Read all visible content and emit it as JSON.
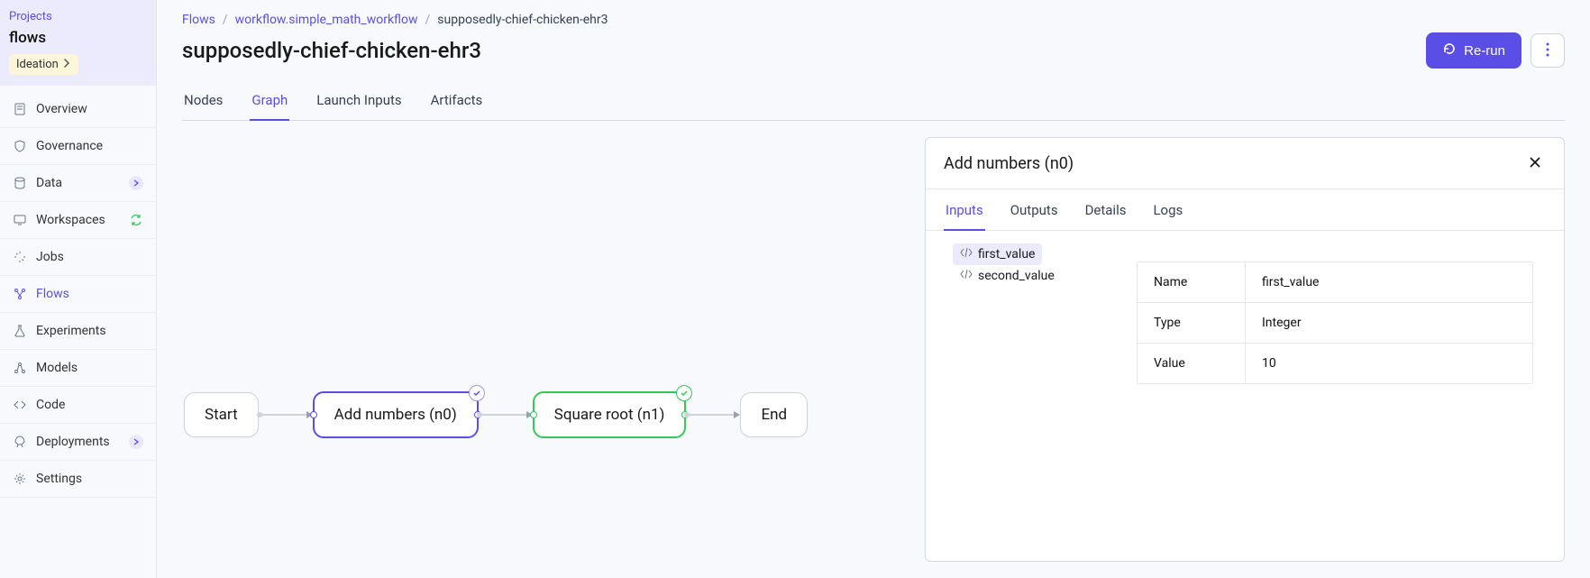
{
  "sidebar": {
    "projects_label": "Projects",
    "project_name": "flows",
    "badge": "Ideation",
    "items": [
      {
        "label": "Overview"
      },
      {
        "label": "Governance"
      },
      {
        "label": "Data"
      },
      {
        "label": "Workspaces"
      },
      {
        "label": "Jobs"
      },
      {
        "label": "Flows"
      },
      {
        "label": "Experiments"
      },
      {
        "label": "Models"
      },
      {
        "label": "Code"
      },
      {
        "label": "Deployments"
      },
      {
        "label": "Settings"
      }
    ]
  },
  "breadcrumb": {
    "root": "Flows",
    "workflow": "workflow.simple_math_workflow",
    "current": "supposedly-chief-chicken-ehr3"
  },
  "page_title": "supposedly-chief-chicken-ehr3",
  "actions": {
    "rerun": "Re-run"
  },
  "tabs": [
    "Nodes",
    "Graph",
    "Launch Inputs",
    "Artifacts"
  ],
  "active_tab": "Graph",
  "graph": {
    "nodes": {
      "start": "Start",
      "add": "Add numbers (n0)",
      "sqrt": "Square root (n1)",
      "end": "End"
    }
  },
  "panel": {
    "title": "Add numbers (n0)",
    "tabs": [
      "Inputs",
      "Outputs",
      "Details",
      "Logs"
    ],
    "active_tab": "Inputs",
    "tree": [
      {
        "label": "first_value",
        "selected": true
      },
      {
        "label": "second_value",
        "selected": false
      }
    ],
    "props": [
      {
        "key": "Name",
        "value": "first_value"
      },
      {
        "key": "Type",
        "value": "Integer"
      },
      {
        "key": "Value",
        "value": "10"
      }
    ]
  }
}
